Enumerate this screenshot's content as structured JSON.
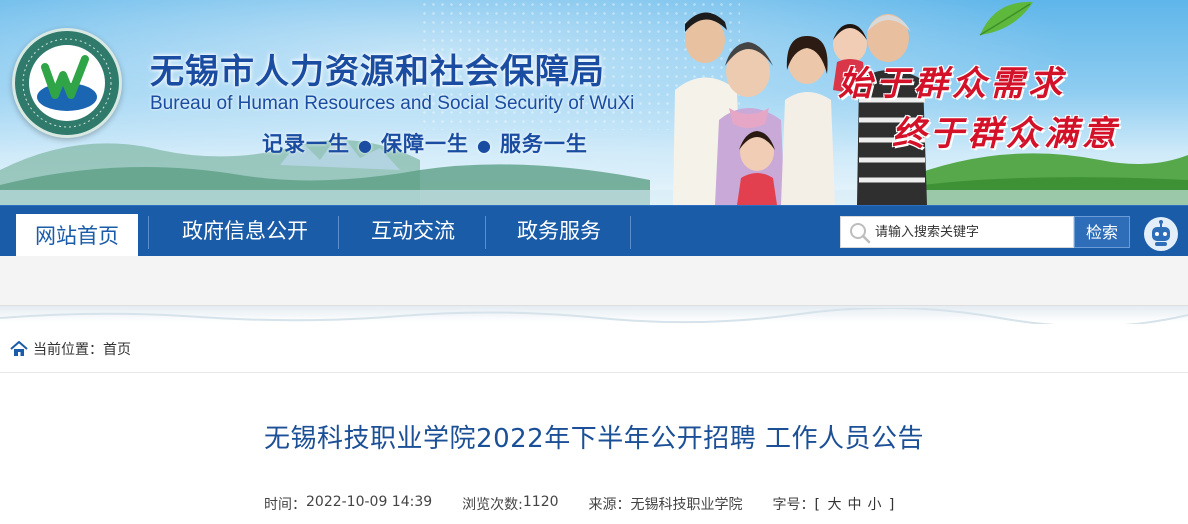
{
  "banner": {
    "org_name_cn": "无锡市人力资源和社会保障局",
    "org_name_en": "Bureau of Human Resources and Social Security of WuXi",
    "slogan": [
      "记录一生",
      "保障一生",
      "服务一生"
    ],
    "poem_line1": "始于群众需求",
    "poem_line2": "终于群众满意",
    "emblem_ring_text": "无锡市人力资源和社会保障局"
  },
  "nav": {
    "items": [
      {
        "label": "网站首页",
        "active": true
      },
      {
        "label": "政府信息公开",
        "active": false
      },
      {
        "label": "互动交流",
        "active": false
      },
      {
        "label": "政务服务",
        "active": false
      }
    ],
    "search_placeholder": "请输入搜索关键字",
    "search_button": "检索"
  },
  "breadcrumb": {
    "label": "当前位置：",
    "path": "首页"
  },
  "article": {
    "title": "无锡科技职业学院2022年下半年公开招聘 工作人员公告",
    "time_label": "时间：",
    "time": "2022-10-09 14:39",
    "views_label": "浏览次数:",
    "views": "1120",
    "source_label": "来源：",
    "source": "无锡科技职业学院",
    "font_label": "字号：",
    "font_open": "[",
    "font_sizes": [
      "大",
      "中",
      "小"
    ],
    "font_close": "]"
  },
  "colors": {
    "nav_bg": "#1b5ca8",
    "title_blue": "#1a4da1",
    "poem_red": "#d3122a"
  }
}
